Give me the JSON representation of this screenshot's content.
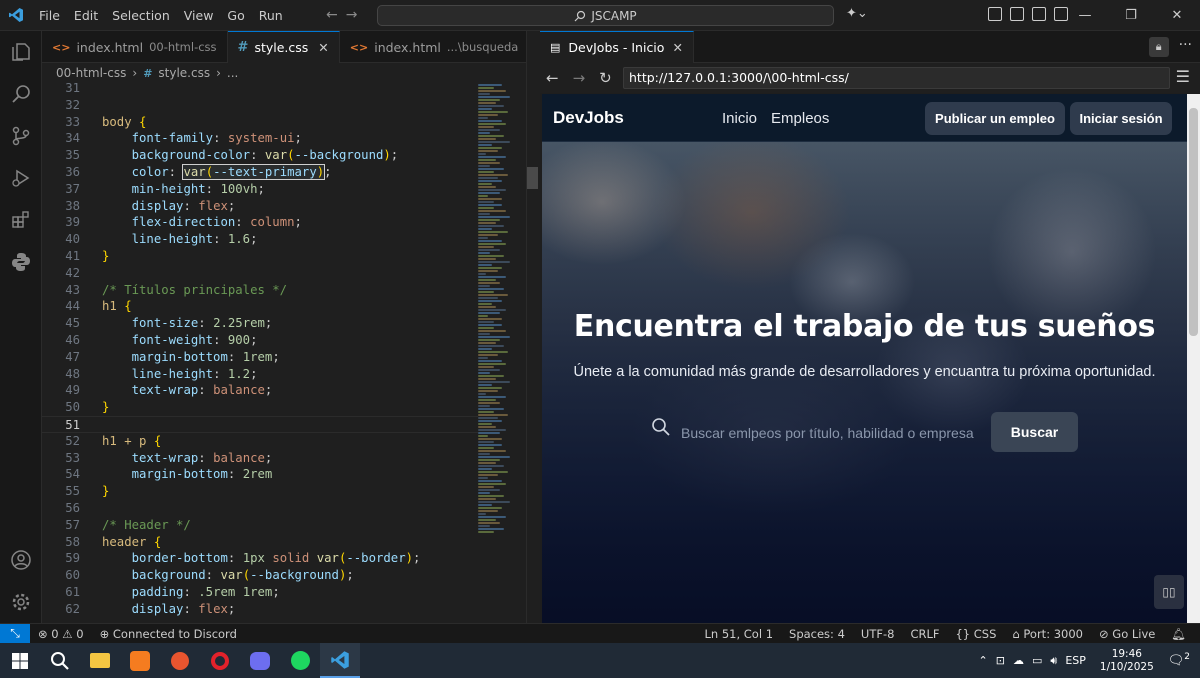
{
  "menu": [
    "File",
    "Edit",
    "Selection",
    "View",
    "Go",
    "Run"
  ],
  "command_center": "JSCAMP",
  "tabs": [
    {
      "name": "index.html",
      "desc": "00-html-css",
      "type": "html"
    },
    {
      "name": "style.css",
      "desc": "",
      "type": "css"
    },
    {
      "name": "index.html",
      "desc": "...\\busqueda",
      "type": "html"
    }
  ],
  "breadcrumb": {
    "folder": "00-html-css",
    "file": "style.css",
    "tail": "..."
  },
  "code": [
    {
      "n": "31",
      "t": ""
    },
    {
      "n": "32",
      "t": ""
    },
    {
      "n": "33",
      "t": "body {"
    },
    {
      "n": "34",
      "t": "    font-family: system-ui;"
    },
    {
      "n": "35",
      "t": "    background-color: var(--background);"
    },
    {
      "n": "36",
      "t": "    color: var(--text-primary);"
    },
    {
      "n": "37",
      "t": "    min-height: 100vh;"
    },
    {
      "n": "38",
      "t": "    display: flex;"
    },
    {
      "n": "39",
      "t": "    flex-direction: column;"
    },
    {
      "n": "40",
      "t": "    line-height: 1.6;"
    },
    {
      "n": "41",
      "t": "}"
    },
    {
      "n": "42",
      "t": ""
    },
    {
      "n": "43",
      "t": "/* Títulos principales */"
    },
    {
      "n": "44",
      "t": "h1 {"
    },
    {
      "n": "45",
      "t": "    font-size: 2.25rem;"
    },
    {
      "n": "46",
      "t": "    font-weight: 900;"
    },
    {
      "n": "47",
      "t": "    margin-bottom: 1rem;"
    },
    {
      "n": "48",
      "t": "    line-height: 1.2;"
    },
    {
      "n": "49",
      "t": "    text-wrap: balance;"
    },
    {
      "n": "50",
      "t": "}"
    },
    {
      "n": "51",
      "t": ""
    },
    {
      "n": "52",
      "t": "h1 + p {"
    },
    {
      "n": "53",
      "t": "    text-wrap: balance;"
    },
    {
      "n": "54",
      "t": "    margin-bottom: 2rem"
    },
    {
      "n": "55",
      "t": "}"
    },
    {
      "n": "56",
      "t": ""
    },
    {
      "n": "57",
      "t": "/* Header */"
    },
    {
      "n": "58",
      "t": "header {"
    },
    {
      "n": "59",
      "t": "    border-bottom: 1px solid var(--border);"
    },
    {
      "n": "60",
      "t": "    background: var(--background);"
    },
    {
      "n": "61",
      "t": "    padding: .5rem 1rem;"
    },
    {
      "n": "62",
      "t": "    display: flex;"
    }
  ],
  "browser": {
    "tab_title": "DevJobs - Inicio",
    "url": "http://127.0.0.1:3000/\\00-html-css/"
  },
  "site": {
    "logo": "DevJobs",
    "nav": [
      "Inicio",
      "Empleos"
    ],
    "publish_btn": "Publicar un empleo",
    "login_btn": "Iniciar sesión",
    "hero_title": "Encuentra el trabajo de tus sueños",
    "hero_sub": "Únete a la comunidad más grande de desarrolladores y encuantra tu próxima oportunidad.",
    "search_placeholder": "Buscar emlpeos por título, habilidad o empresa",
    "search_btn": "Buscar"
  },
  "status": {
    "errors": "0",
    "warnings": "0",
    "discord": "Connected to Discord",
    "position": "Ln 51, Col 1",
    "spaces": "Spaces: 4",
    "encoding": "UTF-8",
    "eol": "CRLF",
    "language": "CSS",
    "port": "Port: 3000",
    "golive": "Go Live"
  },
  "taskbar": {
    "lang": "ESP",
    "time": "19:46",
    "date": "1/10/2025",
    "notif": "2"
  },
  "colors": {
    "accent": "#0078d4",
    "site_bg": "#0c1a2b",
    "button": "#2f3b4d"
  }
}
